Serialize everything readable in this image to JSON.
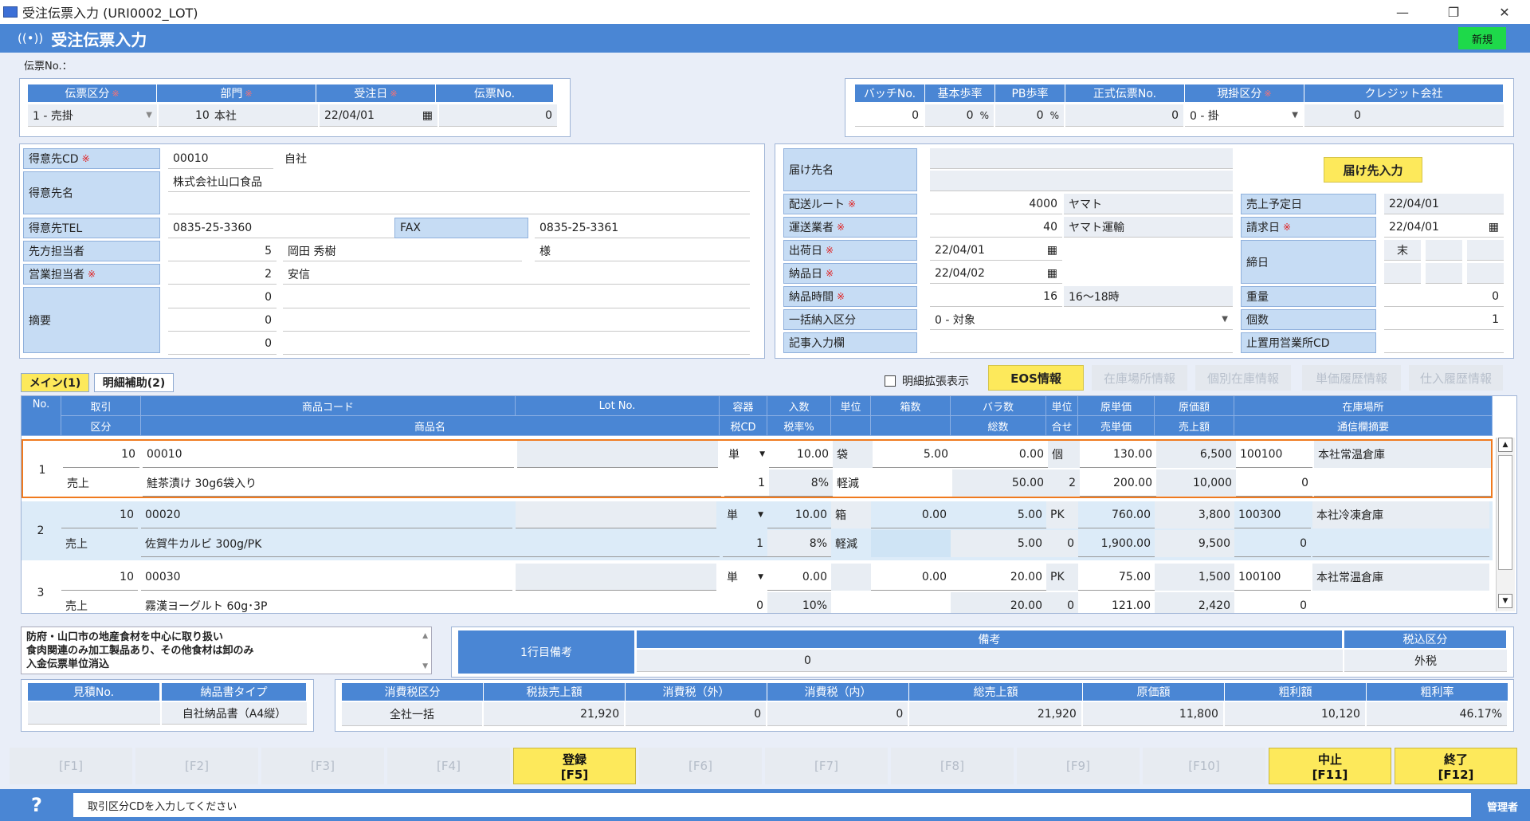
{
  "window": {
    "title": "受注伝票入力 (URI0002_LOT)",
    "min": "—",
    "restore": "❐",
    "close": "✕"
  },
  "header": {
    "icon": "((•))",
    "title": "受注伝票入力",
    "mode_badge": "新規"
  },
  "denpyo_no_label": "伝票No.：",
  "top_left": {
    "headers": [
      "伝票区分",
      "部門",
      "受注日",
      "伝票No."
    ],
    "req": "※",
    "kubun": "1 - 売掛",
    "bumon_code": "10",
    "bumon_name": "本社",
    "date": "22/04/01",
    "no": "0"
  },
  "top_right": {
    "headers": [
      "バッチNo.",
      "基本歩率",
      "PB歩率",
      "正式伝票No.",
      "現掛区分",
      "クレジット会社"
    ],
    "batch": "0",
    "kihon": "0",
    "pct": "%",
    "pb": "0",
    "seishiki": "0",
    "genkake": "0 - 掛",
    "credit": "0"
  },
  "customer": {
    "cd_label": "得意先CD",
    "cd": "00010",
    "cd_name": "自社",
    "name_label": "得意先名",
    "name": "株式会社山口食品",
    "tel_label": "得意先TEL",
    "tel": "0835-25-3360",
    "fax_label": "FAX",
    "fax": "0835-25-3361",
    "saki_label": "先方担当者",
    "saki_code": "5",
    "saki_name": "岡田 秀樹",
    "saki_suffix": "様",
    "eigyo_label": "営業担当者",
    "eigyo_code": "2",
    "eigyo_name": "安信",
    "tekiyo_label": "摘要",
    "tekiyo": [
      "0",
      "0",
      "0"
    ]
  },
  "delivery": {
    "todoke_label": "届け先名",
    "todoke_btn": "届け先入力",
    "route_label": "配送ルート",
    "route_code": "4000",
    "route_name": "ヤマト",
    "gyosha_label": "運送業者",
    "gyosha_code": "40",
    "gyosha_name": "ヤマト運輸",
    "shukka_label": "出荷日",
    "shukka": "22/04/01",
    "nohin_label": "納品日",
    "nohin": "22/04/02",
    "jikan_label": "納品時間",
    "jikan_code": "16",
    "jikan_name": "16～18時",
    "ikkatsu_label": "一括納入区分",
    "ikkatsu": "0 - 対象",
    "kiji_label": "記事入力欄",
    "uriage_label": "売上予定日",
    "uriage": "22/04/01",
    "seikyu_label": "請求日",
    "seikyu": "22/04/01",
    "shime_label": "締日",
    "shime": "末",
    "juryo_label": "重量",
    "juryo": "0",
    "kosu_label": "個数",
    "kosu": "1",
    "tomeoki_label": "止置用営業所CD"
  },
  "tabs": {
    "main": "メイン(1)",
    "sub": "明細補助(2)"
  },
  "toolbar": {
    "expand": "明細拡張表示",
    "eos": "EOS情報",
    "zaiko": "在庫場所情報",
    "kobetsu": "個別在庫情報",
    "tanka": "単価履歴情報",
    "shiire": "仕入履歴情報"
  },
  "grid": {
    "h1": [
      "No.",
      "取引",
      "商品コード",
      "Lot No.",
      "容器",
      "入数",
      "単位",
      "箱数",
      "バラ数",
      "単位",
      "原単価",
      "原価額",
      "在庫場所"
    ],
    "h2": [
      "区分",
      "商品名",
      "税CD",
      "税率%",
      "総数",
      "合せ",
      "売単価",
      "売上額",
      "通信欄摘要"
    ],
    "rows": [
      {
        "no": "1",
        "torihiki": "10",
        "kubun": "売上",
        "code": "00010",
        "name": "鮭茶漬け 30g6袋入り",
        "yoki": "単",
        "irisu": "10.00",
        "tani": "袋",
        "zei_cd": "1",
        "zeiritsu": "8%",
        "keigen": "軽減",
        "hako": "5.00",
        "bara": "0.00",
        "sosu": "50.00",
        "tani2": "個",
        "awase": "2",
        "gentanka": "130.00",
        "baitanka": "200.00",
        "genka": "6,500",
        "uriage": "10,000",
        "zaiko_cd": "100100",
        "zaiko": "本社常温倉庫",
        "tsushin": "0"
      },
      {
        "no": "2",
        "torihiki": "10",
        "kubun": "売上",
        "code": "00020",
        "name": "佐賀牛カルビ 300g/PK",
        "yoki": "単",
        "irisu": "10.00",
        "tani": "箱",
        "zei_cd": "1",
        "zeiritsu": "8%",
        "keigen": "軽減",
        "hako": "0.00",
        "bara": "5.00",
        "sosu": "5.00",
        "tani2": "PK",
        "awase": "0",
        "gentanka": "760.00",
        "baitanka": "1,900.00",
        "genka": "3,800",
        "uriage": "9,500",
        "zaiko_cd": "100300",
        "zaiko": "本社冷凍倉庫",
        "tsushin": "0"
      },
      {
        "no": "3",
        "torihiki": "10",
        "kubun": "売上",
        "code": "00030",
        "name": "霧漢ヨーグルト 60g･3P",
        "yoki": "単",
        "irisu": "0.00",
        "tani": "",
        "zei_cd": "0",
        "zeiritsu": "10%",
        "keigen": "",
        "hako": "0.00",
        "bara": "20.00",
        "sosu": "20.00",
        "tani2": "PK",
        "awase": "0",
        "gentanka": "75.00",
        "baitanka": "121.00",
        "genka": "1,500",
        "uriage": "2,420",
        "zaiko_cd": "100100",
        "zaiko": "本社常温倉庫",
        "tsushin": "0"
      }
    ]
  },
  "memo": [
    "防府・山口市の地産食材を中心に取り扱い",
    "食肉関連のみ加工製品あり、その他食材は卸のみ",
    "入金伝票単位消込"
  ],
  "biko": {
    "label": "1行目備考",
    "h_biko": "備考",
    "h_zeikomi": "税込区分",
    "value": "0",
    "zeikomi": "外税"
  },
  "mitsumori": {
    "h": [
      "見積No.",
      "納品書タイプ"
    ],
    "type": "自社納品書（A4縦）"
  },
  "totals": {
    "h": [
      "消費税区分",
      "税抜売上額",
      "消費税（外）",
      "消費税（内）",
      "総売上額",
      "原価額",
      "粗利額",
      "粗利率"
    ],
    "v": [
      "全社一括",
      "21,920",
      "0",
      "0",
      "21,920",
      "11,800",
      "10,120",
      "46.17%"
    ]
  },
  "fkeys": [
    {
      "l": "",
      "k": "[F1]",
      "on": false
    },
    {
      "l": "",
      "k": "[F2]",
      "on": false
    },
    {
      "l": "",
      "k": "[F3]",
      "on": false
    },
    {
      "l": "",
      "k": "[F4]",
      "on": false
    },
    {
      "l": "登録",
      "k": "[F5]",
      "on": true
    },
    {
      "l": "",
      "k": "[F6]",
      "on": false
    },
    {
      "l": "",
      "k": "[F7]",
      "on": false
    },
    {
      "l": "",
      "k": "[F8]",
      "on": false
    },
    {
      "l": "",
      "k": "[F9]",
      "on": false
    },
    {
      "l": "",
      "k": "[F10]",
      "on": false
    },
    {
      "l": "中止",
      "k": "[F11]",
      "on": true
    },
    {
      "l": "終了",
      "k": "[F12]",
      "on": true
    }
  ],
  "status": {
    "help": "?",
    "message": "取引区分CDを入力してください",
    "user": "管理者"
  }
}
